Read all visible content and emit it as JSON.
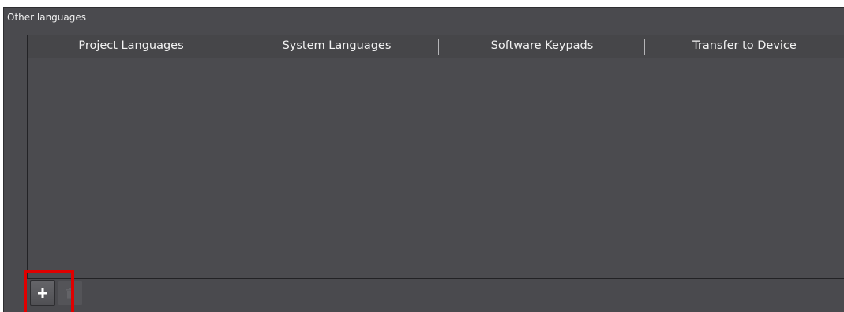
{
  "panel": {
    "title": "Other languages"
  },
  "table": {
    "columns": [
      "Project Languages",
      "System Languages",
      "Software Keypads",
      "Transfer to Device"
    ],
    "rows": []
  },
  "toolbar": {
    "buttons": [
      {
        "icon": "plus-icon",
        "enabled": true
      },
      {
        "icon": "trash-icon",
        "enabled": false
      }
    ]
  },
  "colors": {
    "panel_background": "#4a4a4e",
    "text": "#f2f2f2",
    "highlight": "#e00000"
  }
}
